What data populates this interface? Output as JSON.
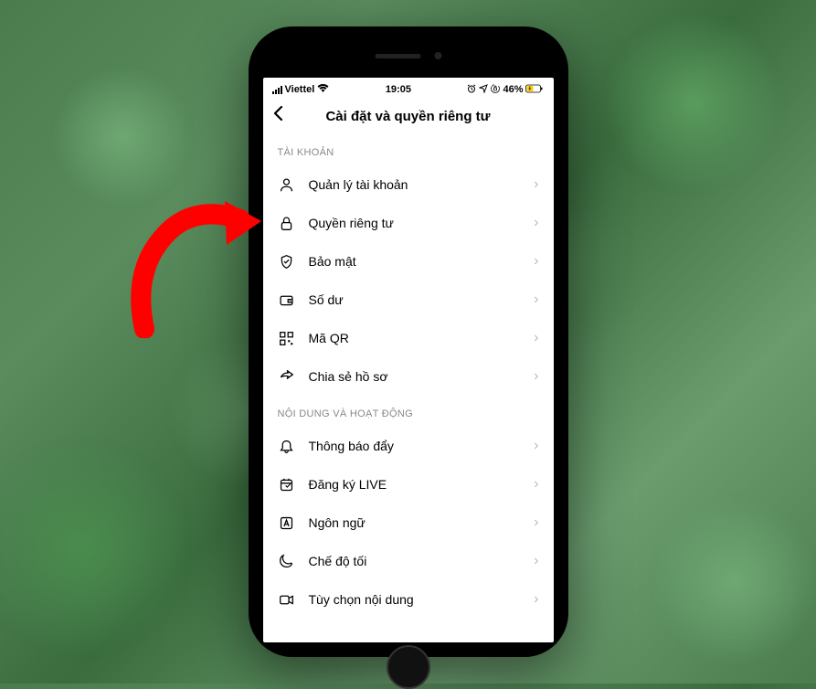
{
  "status_bar": {
    "carrier": "Viettel",
    "time": "19:05",
    "battery": "46%"
  },
  "header": {
    "title": "Cài đặt và quyền riêng tư"
  },
  "sections": {
    "account": {
      "header": "TÀI KHOẢN",
      "items": [
        {
          "icon": "user",
          "label": "Quản lý tài khoản"
        },
        {
          "icon": "lock",
          "label": "Quyền riêng tư"
        },
        {
          "icon": "shield",
          "label": "Bảo mật"
        },
        {
          "icon": "wallet",
          "label": "Số dư"
        },
        {
          "icon": "qr",
          "label": "Mã QR"
        },
        {
          "icon": "share",
          "label": "Chia sẻ hồ sơ"
        }
      ]
    },
    "content": {
      "header": "NỘI DUNG VÀ HOẠT ĐỘNG",
      "items": [
        {
          "icon": "bell",
          "label": "Thông báo đẩy"
        },
        {
          "icon": "calendar",
          "label": "Đăng ký LIVE"
        },
        {
          "icon": "language",
          "label": "Ngôn ngữ"
        },
        {
          "icon": "moon",
          "label": "Chế độ tối"
        },
        {
          "icon": "video",
          "label": "Tùy chọn nội dung"
        }
      ]
    }
  }
}
